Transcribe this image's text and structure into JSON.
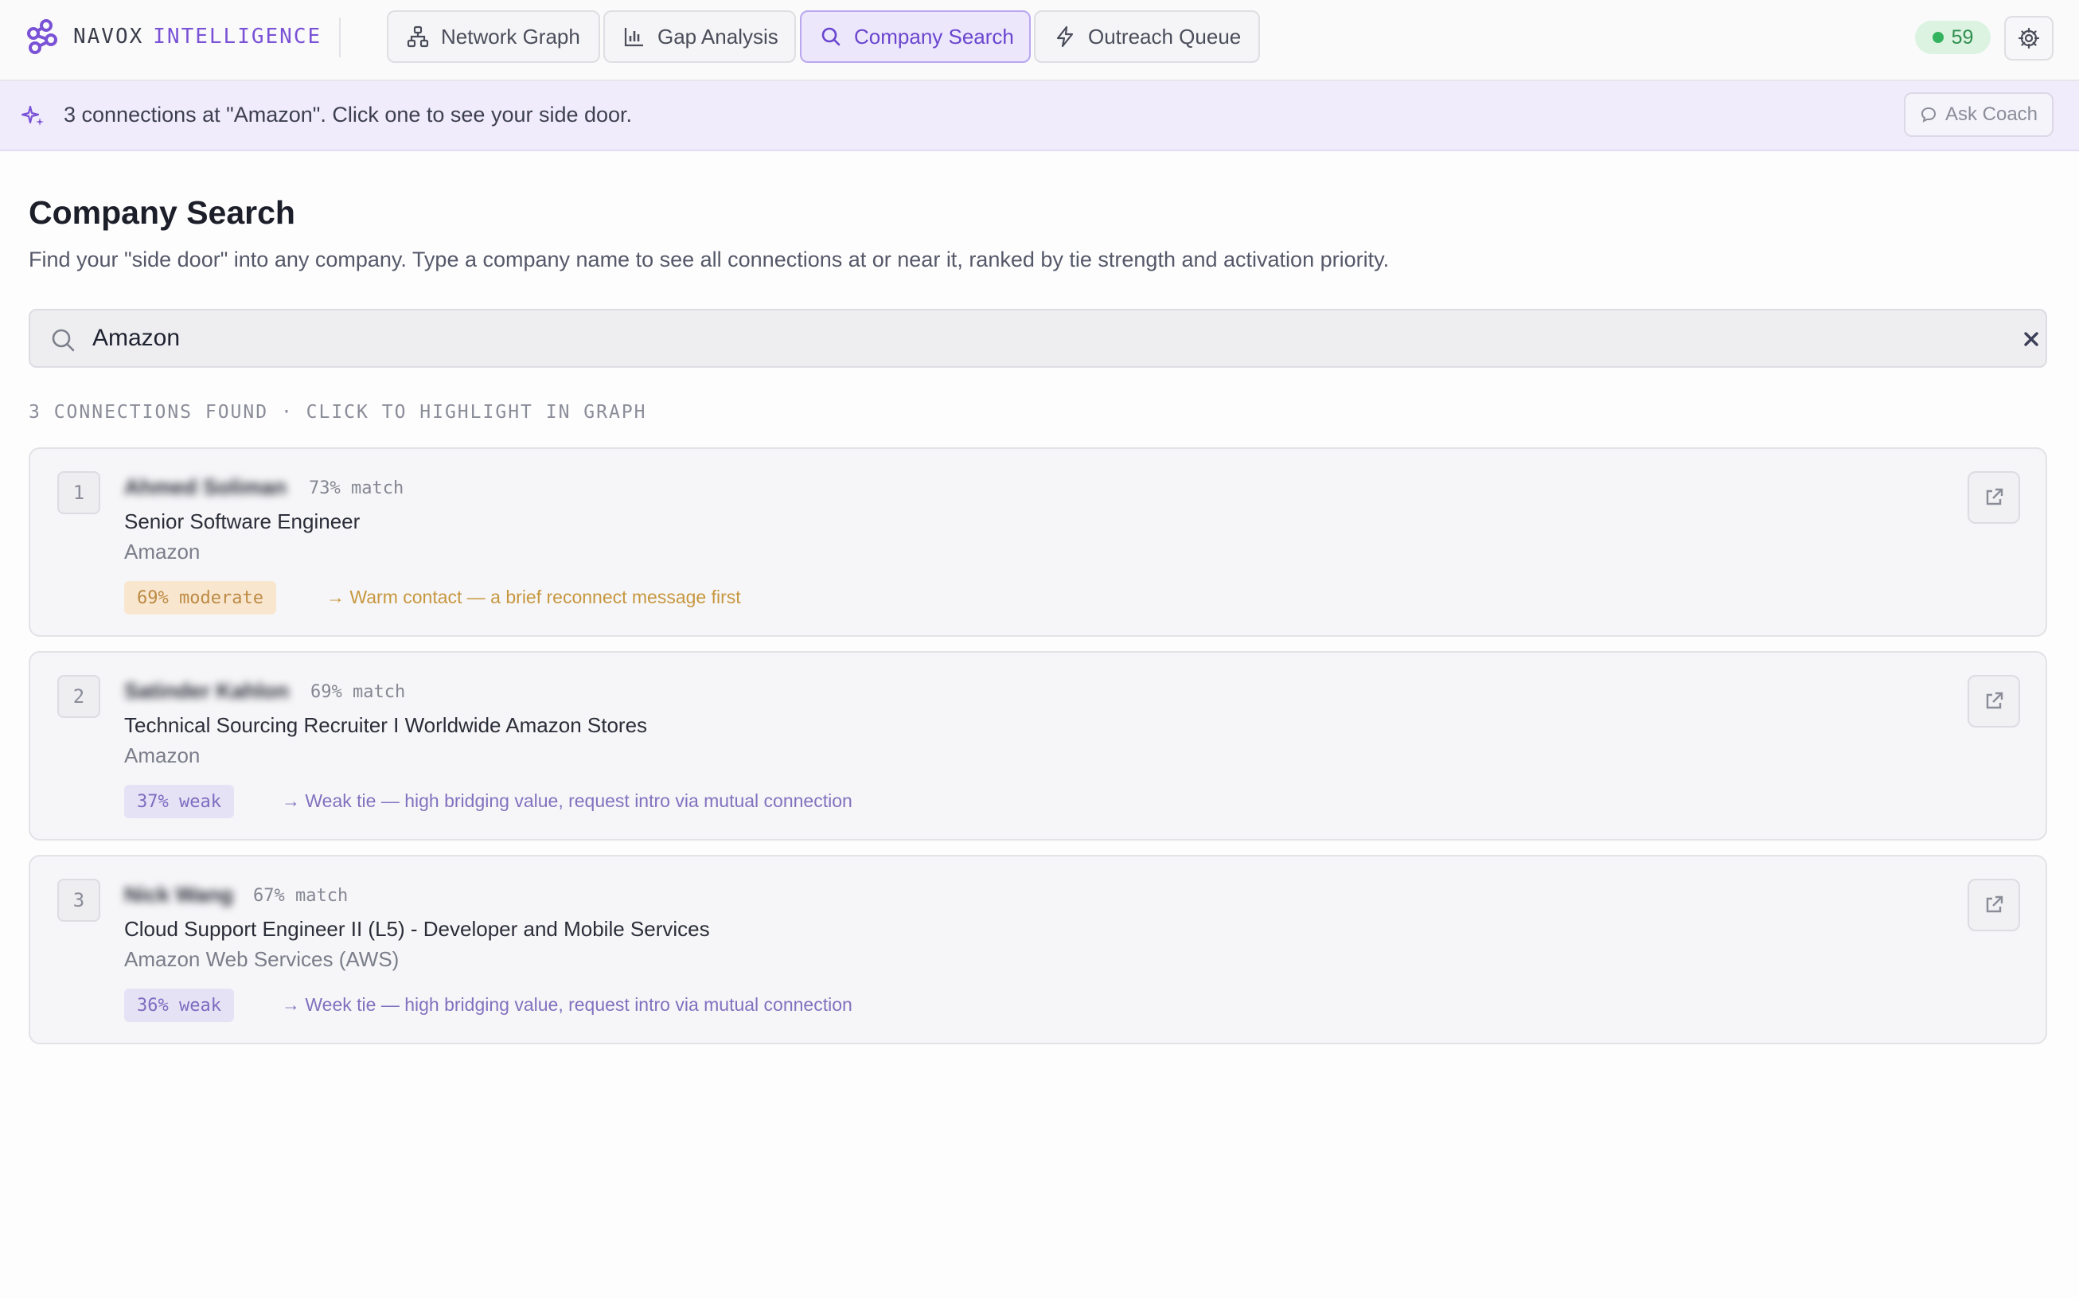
{
  "brand": {
    "part1": "NAVOX",
    "part2": "INTELLIGENCE"
  },
  "tabs": [
    {
      "label": "Network Graph",
      "icon": "network-icon",
      "active": false
    },
    {
      "label": "Gap Analysis",
      "icon": "bar-chart-icon",
      "active": false
    },
    {
      "label": "Company Search",
      "icon": "search-icon",
      "active": true
    },
    {
      "label": "Outreach Queue",
      "icon": "lightning-icon",
      "active": false
    }
  ],
  "header": {
    "score": "59",
    "score_color": "#34b35e",
    "settings_icon": "gear-icon"
  },
  "banner": {
    "message": "3 connections at \"Amazon\". Click one to see your side door.",
    "icon": "sparkle-icon",
    "coach_label": "Ask Coach"
  },
  "main": {
    "title": "Company Search",
    "description": "Find your \"side door\" into any company. Type a company name to see all connections at or near it, ranked by tie strength and activation priority.",
    "search": {
      "value": "Amazon",
      "icon": "search-icon",
      "clear_icon": "close-icon"
    },
    "results_header": "3 CONNECTIONS FOUND · CLICK TO HIGHLIGHT IN GRAPH",
    "results": [
      {
        "rank": "1",
        "name": "Ahmed Soliman",
        "match": "73% match",
        "role": "Senior Software Engineer",
        "company": "Amazon",
        "tie_label": "69% moderate",
        "tie_type": "moderate",
        "action": "→ Warm contact — a brief reconnect message first"
      },
      {
        "rank": "2",
        "name": "Satinder Kahlon",
        "match": "69% match",
        "role": "Technical Sourcing Recruiter I Worldwide Amazon Stores",
        "company": "Amazon",
        "tie_label": "37% weak",
        "tie_type": "weak",
        "action": "→ Weak tie — high bridging value, request intro via mutual connection"
      },
      {
        "rank": "3",
        "name": "Nick Wang",
        "match": "67% match",
        "role": "Cloud Support Engineer II (L5) - Developer and Mobile Services",
        "company": "Amazon Web Services (AWS)",
        "tie_label": "36% weak",
        "tie_type": "weak",
        "action": "→ Week tie — high bridging value, request intro via mutual connection"
      }
    ]
  },
  "colors": {
    "accent": "#7a52d6",
    "moderate": "#c7973f",
    "weak": "#8271bf",
    "status_green": "#34b35e"
  }
}
